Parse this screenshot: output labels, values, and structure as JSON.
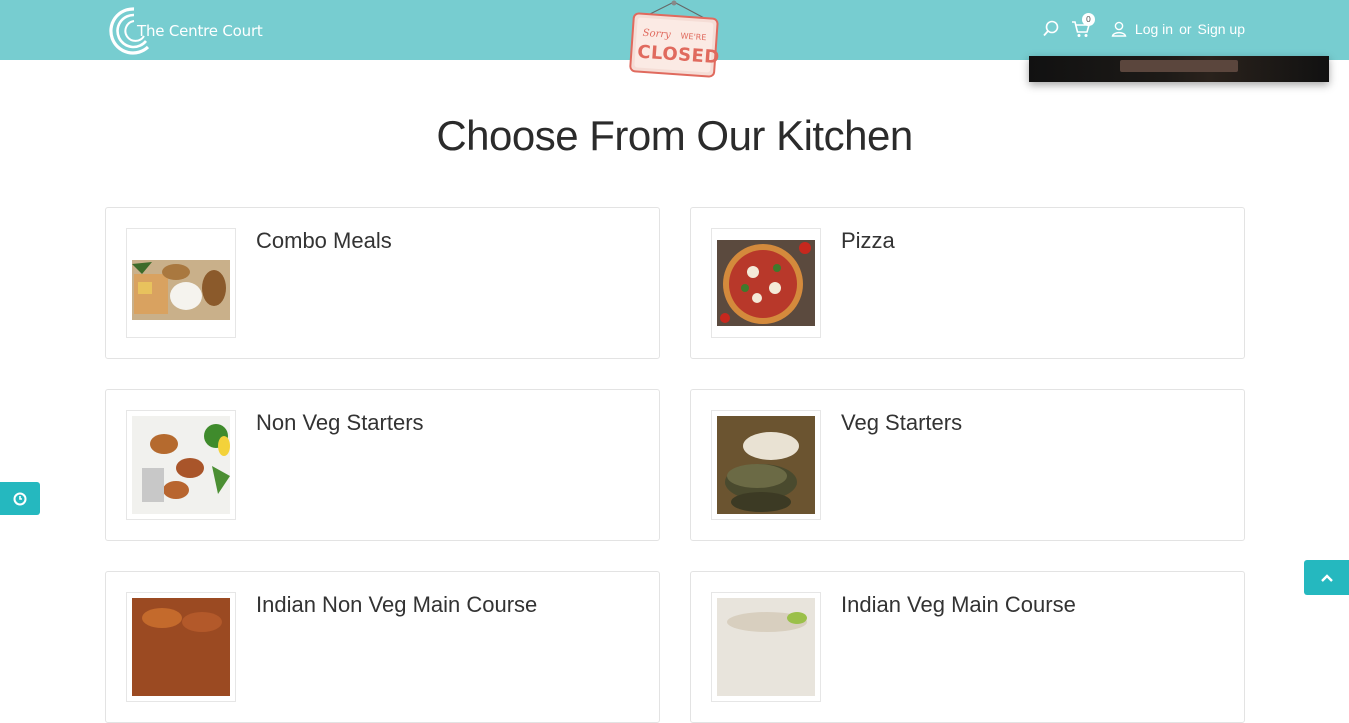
{
  "header": {
    "logo_text": "The Centre Court",
    "closed_sign": {
      "top_text": "Sorry",
      "right_text": "WE'RE",
      "main_text": "CLOSED"
    },
    "cart_count": "0",
    "login_label": "Log in",
    "or_label": "or",
    "signup_label": "Sign up",
    "icons": [
      "search-icon",
      "cart-icon",
      "user-icon"
    ]
  },
  "main": {
    "title": "Choose From Our Kitchen",
    "categories": [
      {
        "name": "Combo Meals"
      },
      {
        "name": "Pizza"
      },
      {
        "name": "Non Veg Starters"
      },
      {
        "name": "Veg Starters"
      },
      {
        "name": "Indian Non Veg Main Course"
      },
      {
        "name": "Indian Veg Main Course"
      }
    ]
  },
  "colors": {
    "header_bg": "#77cdd0",
    "accent": "#25b8bf",
    "sign_red": "#e06a5e"
  },
  "floating": {
    "side_tab_icon": "clock-icon",
    "back_to_top_icon": "chevron-up-icon"
  }
}
